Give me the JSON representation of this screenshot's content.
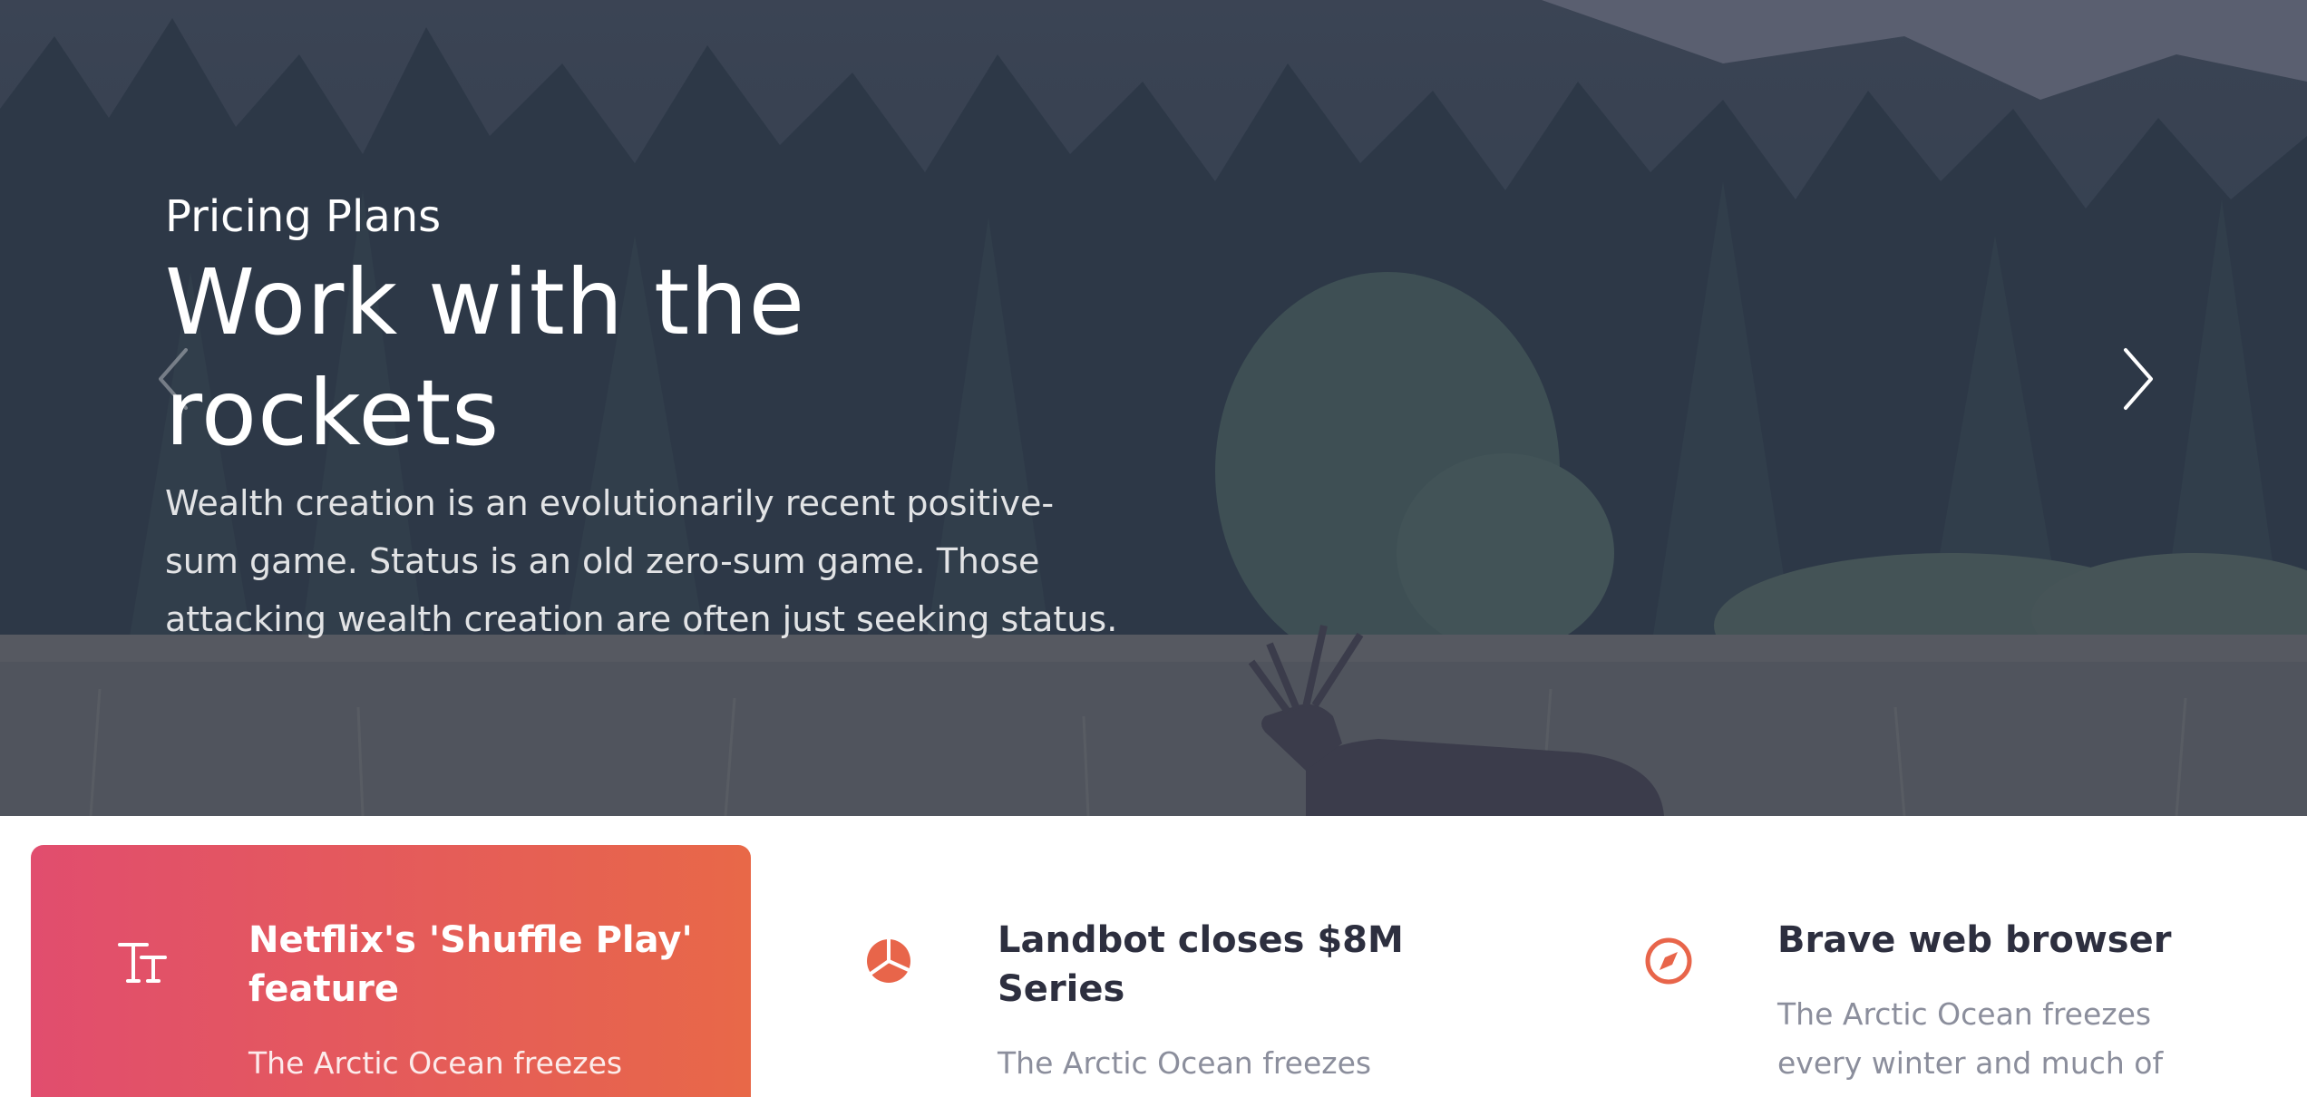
{
  "hero": {
    "eyebrow": "Pricing Plans",
    "title": "Work with the rockets",
    "text": "Wealth creation is an evolutionarily recent positive-sum game. Status is an old zero-sum game. Those attacking wealth creation are often just seeking status.",
    "prev_icon": "chevron-left-icon",
    "next_icon": "chevron-right-icon"
  },
  "features": [
    {
      "icon": "text-size-icon",
      "title": "Netflix's 'Shuffle Play' feature",
      "text": "The Arctic Ocean freezes"
    },
    {
      "icon": "pie-chart-icon",
      "title": "Landbot closes $8M Series",
      "text": "The Arctic Ocean freezes"
    },
    {
      "icon": "compass-icon",
      "title": "Brave web browser",
      "text": "The Arctic Ocean freezes every winter and much of"
    }
  ],
  "colors": {
    "accent": "#e8654a",
    "card_gradient_start": "#e14d6e",
    "card_gradient_end": "#e86848",
    "heading": "#2d2f3f",
    "muted_text": "#8b8e9c"
  }
}
